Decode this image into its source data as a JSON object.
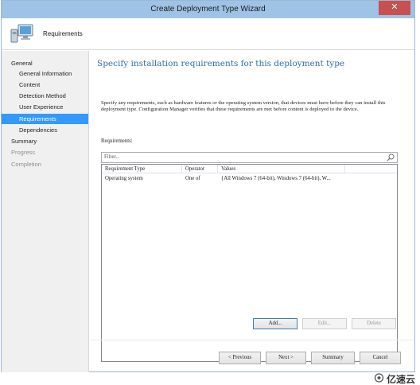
{
  "window": {
    "title": "Create Deployment Type Wizard",
    "close_glyph": "✕",
    "header_title": "Requirements",
    "header_icon": "computer-icon"
  },
  "nav": {
    "items": [
      {
        "label": "General",
        "level": "top",
        "state": "normal"
      },
      {
        "label": "General Information",
        "level": "sub",
        "state": "normal"
      },
      {
        "label": "Content",
        "level": "sub",
        "state": "normal"
      },
      {
        "label": "Detection Method",
        "level": "sub",
        "state": "normal"
      },
      {
        "label": "User Experience",
        "level": "sub",
        "state": "normal"
      },
      {
        "label": "Requirements",
        "level": "sub",
        "state": "selected"
      },
      {
        "label": "Dependencies",
        "level": "sub",
        "state": "normal"
      },
      {
        "label": "Summary",
        "level": "top",
        "state": "normal"
      },
      {
        "label": "Progress",
        "level": "top",
        "state": "disabled"
      },
      {
        "label": "Completion",
        "level": "top",
        "state": "disabled"
      }
    ]
  },
  "main": {
    "heading": "Specify installation requirements for this deployment type",
    "description": "Specify any requirements, such as hardware features or the operating system version, that devices must have before they can install this deployment type. Configuration Manager verifies that these requirements are met before content is deployed to the device.",
    "requirements_label": "Requirements:",
    "filter_placeholder": "Filter...",
    "columns": [
      "Requirement Type",
      "Operator",
      "Values"
    ],
    "rows": [
      [
        "Operating system",
        "One of",
        "{All Windows 7 (64-bit), Windows 7 (64-bit), W..."
      ]
    ],
    "list_buttons": {
      "add": "Add...",
      "edit": "Edit...",
      "delete": "Delete"
    }
  },
  "footer": {
    "previous": "< Previous",
    "next": "Next >",
    "summary": "Summary",
    "cancel": "Cancel"
  },
  "watermark": {
    "text": "亿速云"
  },
  "colors": {
    "titlebar": "#9fc3e6",
    "selected_nav": "#3399ff",
    "heading": "#2f6fa8",
    "close_button": "#c75050"
  }
}
